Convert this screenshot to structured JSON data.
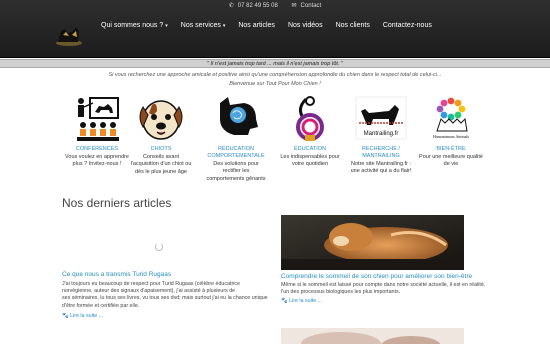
{
  "topbar": {
    "phone": "07 82 49 55 08",
    "contact": "Contact"
  },
  "nav": [
    {
      "label": "Qui sommes nous ?",
      "dropdown": true
    },
    {
      "label": "Nos services",
      "dropdown": true
    },
    {
      "label": "Nos articles",
      "dropdown": false
    },
    {
      "label": "Nos vidéos",
      "dropdown": false
    },
    {
      "label": "Nos clients",
      "dropdown": false
    },
    {
      "label": "Contactez-nous",
      "dropdown": false
    }
  ],
  "quote": "\" Il n'est jamais trop tard ... mais il n'est jamais trop tôt. \"",
  "intro": {
    "line1": "Si vous recherchez une approche amicale et positive ainsi qu'une compréhension approfondie du chien dans le respect total de celui-ci...",
    "line2": "Bienvenue sur Tout Pour Mon Chien !"
  },
  "services": [
    {
      "title": "CONFÉRENCES",
      "desc": "Vous voulez en apprendre plus ? Invitez-nous !",
      "icon": "conference-icon"
    },
    {
      "title": "CHIOTS",
      "desc": "Conseils avant l'acquisition d'un chiot ou dès le plus jeune âge",
      "icon": "puppy-icon"
    },
    {
      "title": "RÉDUCATION COMPORTEMENTALE",
      "desc": "Des solutions pour rectifier les comportements gênants",
      "icon": "dog-brain-icon"
    },
    {
      "title": "ÉDUCATION",
      "desc": "Les indispensables pour votre quotidien",
      "icon": "leash-icon"
    },
    {
      "title": "RECHERCHE / MANTRAILING",
      "desc": "Notre site Mantrailing.fr : une activité qui a du flair!",
      "icon": "mantrailing-logo",
      "logo_text": "Mantrailing.fr"
    },
    {
      "title": "BIEN-ÊTRE",
      "desc": "Pour une meilleure qualité de vie",
      "icon": "wellbeing-logo",
      "logo_text": "Humanimaux Animals"
    }
  ],
  "articles": {
    "heading": "Nos derniers articles",
    "items": [
      {
        "title": "Ce que nous a transmis Turid Rugaas",
        "desc_lines": [
          "J'ai toujours eu beaucoup de respect pour Turid Rugaas (célèbre éducatrice",
          "norvégienne, auteur des signaux d'apaisement), j'ai assisté à plusieurs de",
          "ses séminaires, lu tous ses livres, vu tous ses dvd; mais surtout j'ai eu la chance unique",
          "d'être formée et certifiée par elle."
        ],
        "read_more": "Lire la suite ..."
      },
      {
        "title": "Comprendre le sommeil de son chien pour améliorer son bien-être",
        "desc_lines": [
          "Même si le sommeil est laissé pour compte dans notre société actuelle, il est en réalité,",
          "l'un des processus biologiques les plus importants."
        ],
        "read_more": "Lire la suite ..."
      }
    ]
  },
  "colors": {
    "accent": "#2a8ec4",
    "header_bg": "#262626",
    "quote_band": "#cfcfcf"
  }
}
